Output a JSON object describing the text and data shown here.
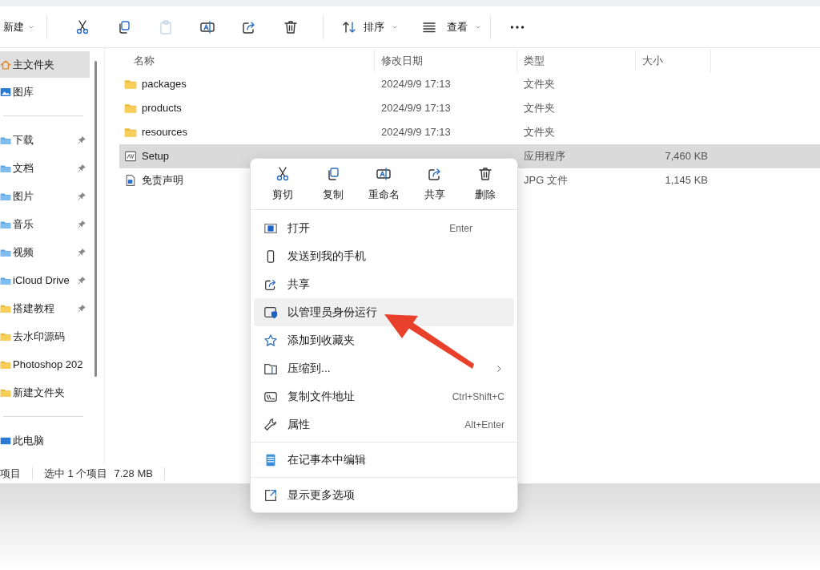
{
  "toolbar": {
    "new_label": "新建",
    "sort_label": "排序",
    "view_label": "查看"
  },
  "sidebar": {
    "items": [
      {
        "label": "主文件夹",
        "kind": "home",
        "pinned": false,
        "selected": true
      },
      {
        "label": "图库",
        "kind": "gallery",
        "pinned": false,
        "selected": false
      },
      {
        "label": "下载",
        "kind": "blue-folder",
        "pinned": true,
        "selected": false,
        "group_start": true
      },
      {
        "label": "文档",
        "kind": "blue-folder",
        "pinned": true,
        "selected": false
      },
      {
        "label": "图片",
        "kind": "blue-folder",
        "pinned": true,
        "selected": false
      },
      {
        "label": "音乐",
        "kind": "blue-folder",
        "pinned": true,
        "selected": false
      },
      {
        "label": "视频",
        "kind": "blue-folder",
        "pinned": true,
        "selected": false
      },
      {
        "label": "iCloud Drive",
        "kind": "blue-folder",
        "pinned": true,
        "selected": false
      },
      {
        "label": "搭建教程",
        "kind": "folder",
        "pinned": true,
        "selected": false
      },
      {
        "label": "去水印源码",
        "kind": "folder",
        "pinned": false,
        "selected": false
      },
      {
        "label": "Photoshop 202",
        "kind": "folder",
        "pinned": false,
        "selected": false
      },
      {
        "label": "新建文件夹",
        "kind": "folder",
        "pinned": false,
        "selected": false
      },
      {
        "label": "此电脑",
        "kind": "pc",
        "pinned": false,
        "selected": false,
        "group_start": true
      }
    ]
  },
  "table": {
    "columns": [
      "名称",
      "修改日期",
      "类型",
      "大小"
    ],
    "rows": [
      {
        "name": "packages",
        "date": "2024/9/9 17:13",
        "type": "文件夹",
        "kind": "folder",
        "selected": false
      },
      {
        "name": "products",
        "date": "2024/9/9 17:13",
        "type": "文件夹",
        "kind": "folder",
        "selected": false
      },
      {
        "name": "resources",
        "date": "2024/9/9 17:13",
        "type": "文件夹",
        "kind": "folder",
        "selected": false
      },
      {
        "name": "Setup",
        "type": "应用程序",
        "size": "7,460 KB",
        "kind": "app",
        "selected": true
      },
      {
        "name": "免责声明",
        "type": "JPG 文件",
        "size": "1,145 KB",
        "kind": "image",
        "selected": false
      }
    ]
  },
  "context_menu": {
    "quick_actions": [
      {
        "label": "剪切"
      },
      {
        "label": "复制"
      },
      {
        "label": "重命名"
      },
      {
        "label": "共享"
      },
      {
        "label": "删除"
      }
    ],
    "groups": [
      [
        {
          "label": "打开",
          "shortcut": "Enter",
          "highlighted": false
        },
        {
          "label": "发送到我的手机",
          "highlighted": false
        },
        {
          "label": "共享",
          "highlighted": false
        },
        {
          "label": "以管理员身份运行",
          "highlighted": true
        },
        {
          "label": "添加到收藏夹",
          "highlighted": false
        },
        {
          "label": "压缩到...",
          "submenu": true,
          "highlighted": false
        },
        {
          "label": "复制文件地址",
          "shortcut": "Ctrl+Shift+C",
          "highlighted": false
        },
        {
          "label": "属性",
          "shortcut": "Alt+Enter",
          "highlighted": false
        }
      ],
      [
        {
          "label": "在记事本中编辑",
          "highlighted": false
        }
      ],
      [
        {
          "label": "显示更多选项",
          "highlighted": false
        }
      ]
    ]
  },
  "status_bar": {
    "count": "项目",
    "selection": "选中 1 个项目",
    "size": "7.28 MB"
  }
}
